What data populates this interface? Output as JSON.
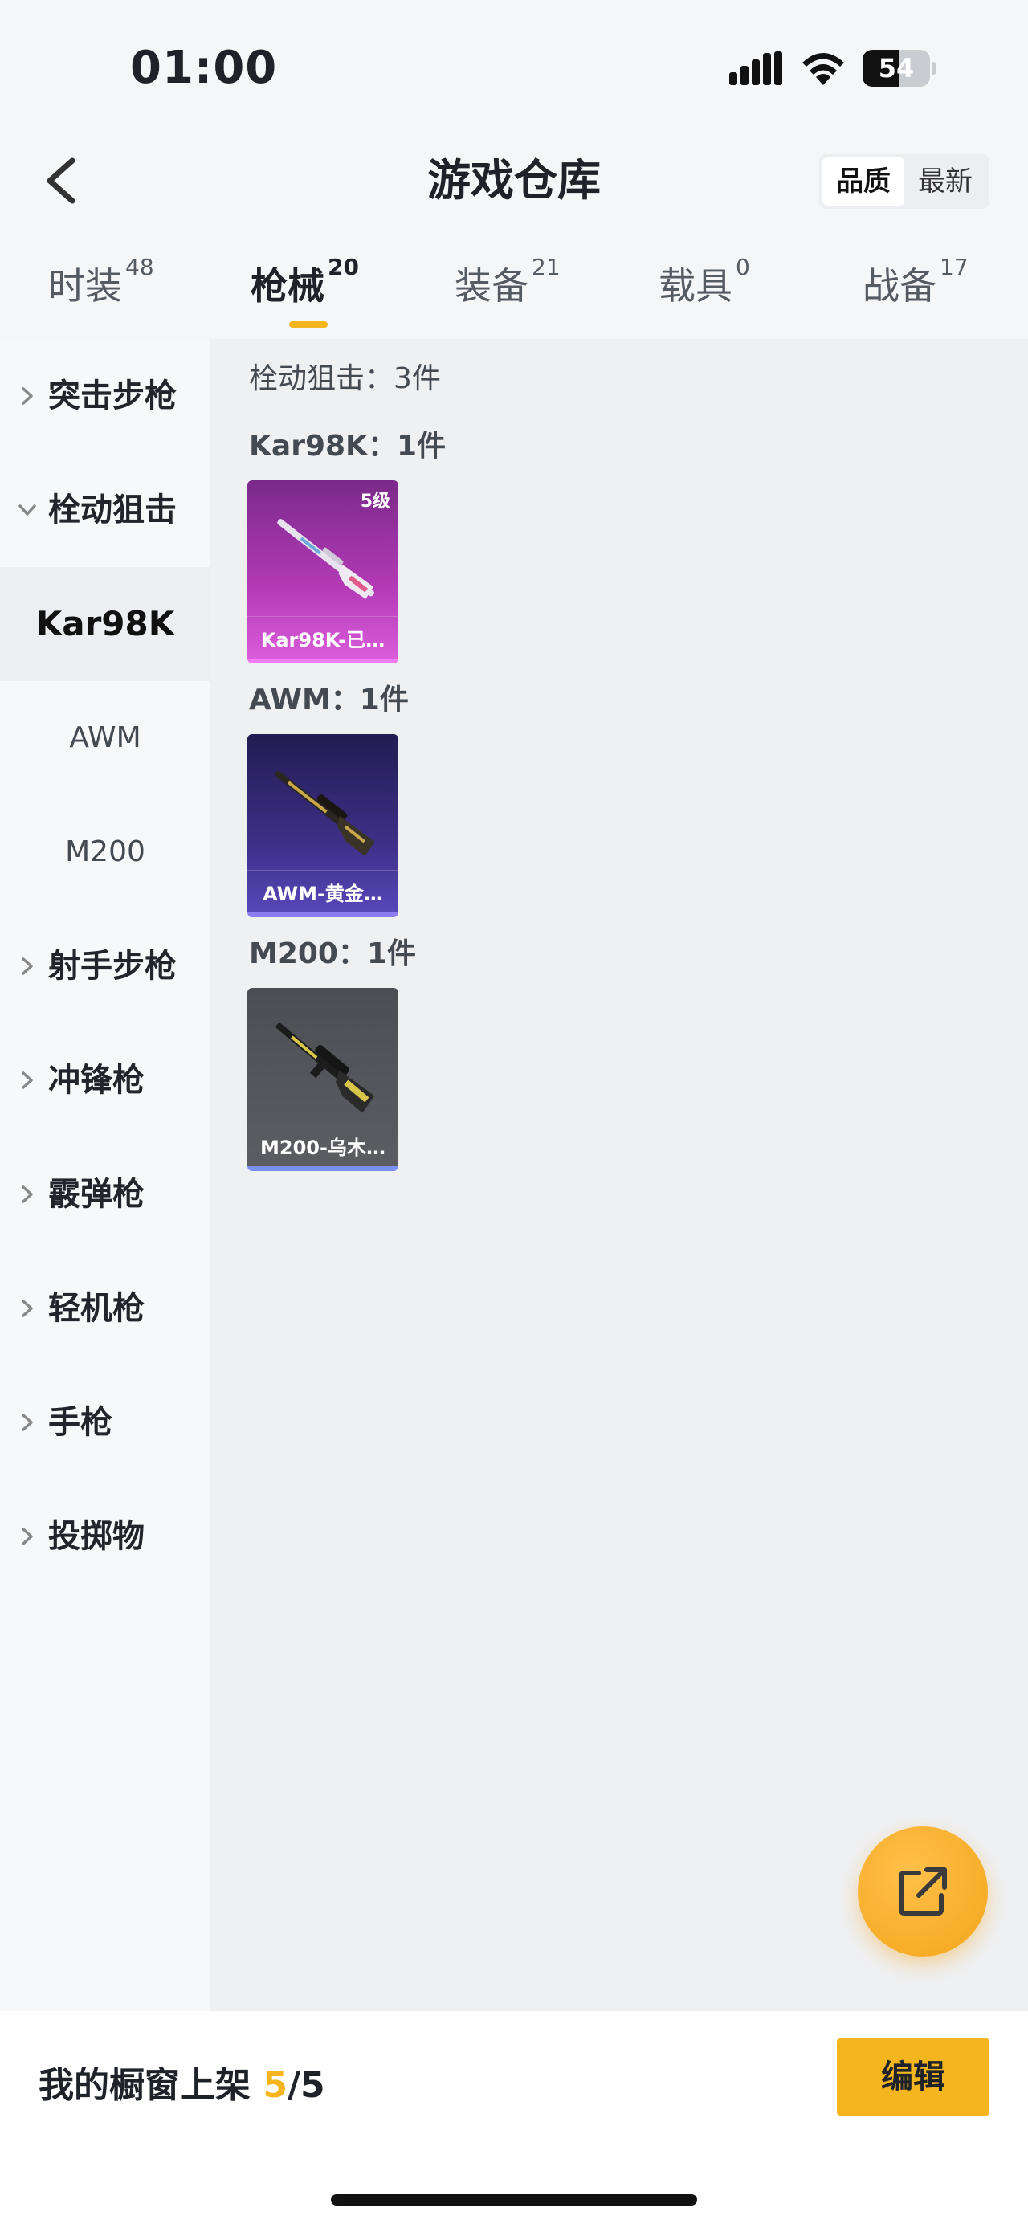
{
  "status": {
    "time": "01:00",
    "battery": "54",
    "battery_level": 0.54
  },
  "nav": {
    "title": "游戏仓库",
    "sort_options": [
      "品质",
      "最新"
    ]
  },
  "tabs": [
    {
      "label": "时装",
      "count": "48"
    },
    {
      "label": "枪械",
      "count": "20"
    },
    {
      "label": "装备",
      "count": "21"
    },
    {
      "label": "载具",
      "count": "0"
    },
    {
      "label": "战备",
      "count": "17"
    }
  ],
  "sidebar": {
    "items": [
      {
        "label": "突击步枪"
      },
      {
        "label": "栓动狙击"
      },
      {
        "label": "射手步枪"
      },
      {
        "label": "冲锋枪"
      },
      {
        "label": "霰弹枪"
      },
      {
        "label": "轻机枪"
      },
      {
        "label": "手枪"
      },
      {
        "label": "投掷物"
      }
    ],
    "sub_items": [
      "Kar98K",
      "AWM",
      "M200"
    ]
  },
  "content": {
    "section_title": "栓动狙击：3件",
    "groups": [
      {
        "title": "Kar98K：1件",
        "item_name": "Kar98K-已…",
        "level": "5级"
      },
      {
        "title": "AWM：1件",
        "item_name": "AWM-黄金…"
      },
      {
        "title": "M200：1件",
        "item_name": "M200-乌木…"
      }
    ]
  },
  "fab": {
    "icon": "share-external-icon"
  },
  "bottom": {
    "prefix": "我的橱窗上架 ",
    "current": "5",
    "separator": "/",
    "total": "5",
    "edit_label": "编辑"
  },
  "colors": {
    "accent": "#f4b51f",
    "pink_quality": "#b33ab6",
    "purple_quality": "#3d2f86",
    "gray_quality": "#5b5d63"
  }
}
